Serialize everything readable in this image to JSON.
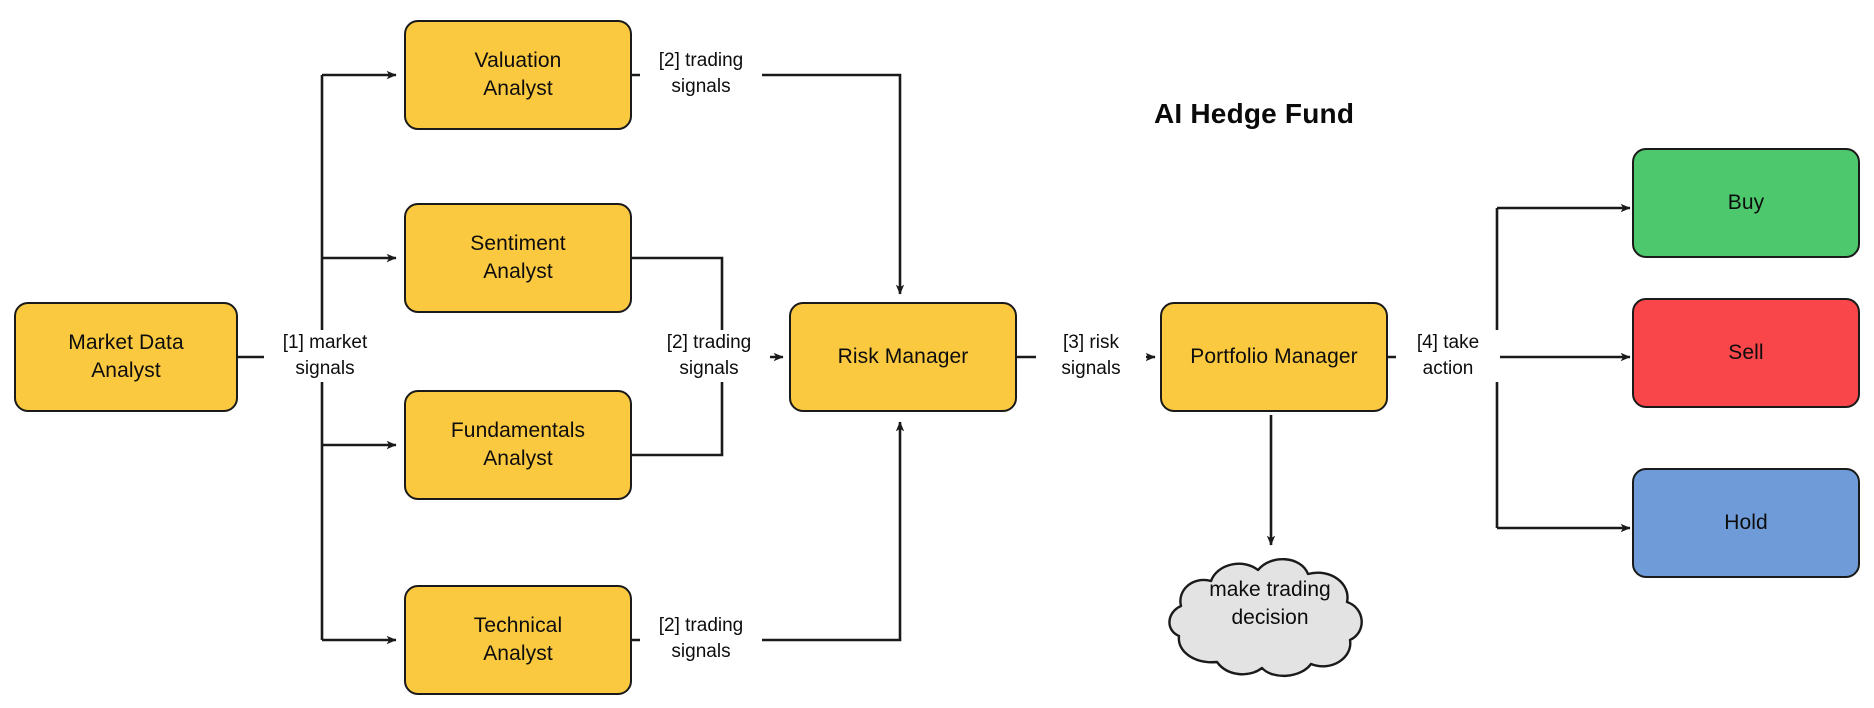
{
  "diagram": {
    "title": "AI Hedge Fund",
    "background_color": "#ffffff",
    "stroke_color": "#1a1a1a",
    "colors": {
      "agent": "#fbc940",
      "buy": "#4dc86c",
      "sell": "#f8464a",
      "hold": "#6f9cd8",
      "cloud": "#e3e3e3"
    }
  },
  "nodes": {
    "market_data_analyst": "Market Data\nAnalyst",
    "valuation_analyst": "Valuation\nAnalyst",
    "sentiment_analyst": "Sentiment\nAnalyst",
    "fundamentals_analyst": "Fundamentals\nAnalyst",
    "technical_analyst": "Technical\nAnalyst",
    "risk_manager": "Risk Manager",
    "portfolio_manager": "Portfolio Manager",
    "buy": "Buy",
    "sell": "Sell",
    "hold": "Hold",
    "trading_decision": "make trading\ndecision"
  },
  "edge_labels": {
    "market_signals": "[1] market\nsignals",
    "trading_signals_valuation": "[2] trading\nsignals",
    "trading_signals_mid": "[2] trading\nsignals",
    "trading_signals_technical": "[2] trading\nsignals",
    "risk_signals": "[3] risk\nsignals",
    "take_action": "[4] take\naction"
  }
}
